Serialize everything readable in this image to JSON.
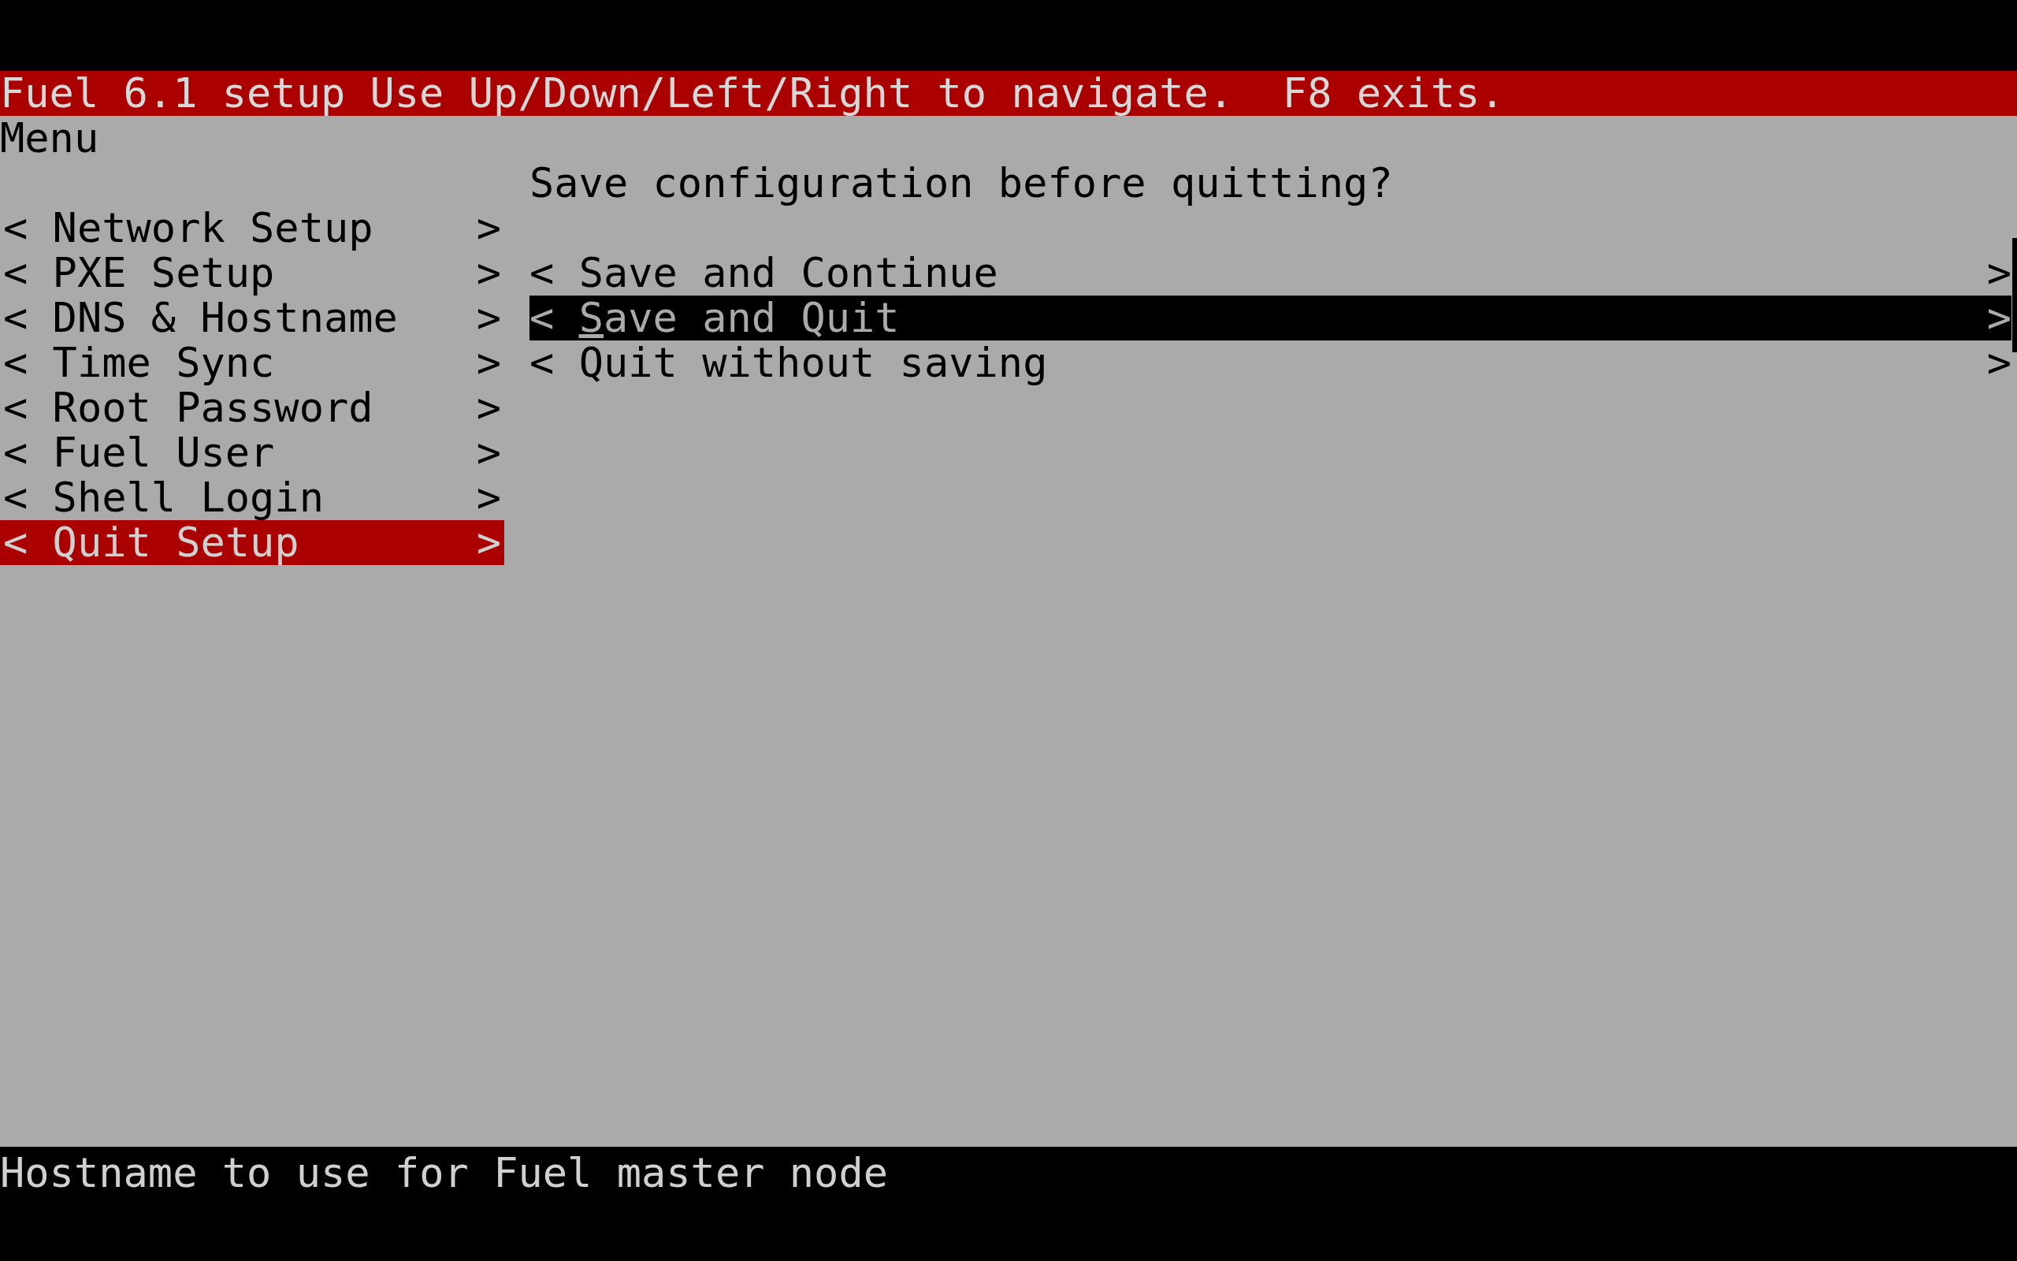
{
  "header": {
    "title": "Fuel 6.1 setup",
    "hint": "Use Up/Down/Left/Right to navigate.  F8 exits."
  },
  "menu": {
    "title": "Menu",
    "items": [
      {
        "left_mark": "<",
        "label": "Network Setup",
        "right_mark": ">",
        "selected": false
      },
      {
        "left_mark": "<",
        "label": "PXE Setup",
        "right_mark": ">",
        "selected": false
      },
      {
        "left_mark": "<",
        "label": "DNS & Hostname",
        "right_mark": ">",
        "selected": false
      },
      {
        "left_mark": "<",
        "label": "Time Sync",
        "right_mark": ">",
        "selected": false
      },
      {
        "left_mark": "<",
        "label": "Root Password",
        "right_mark": ">",
        "selected": false
      },
      {
        "left_mark": "<",
        "label": "Fuel User",
        "right_mark": ">",
        "selected": false
      },
      {
        "left_mark": "<",
        "label": "Shell Login",
        "right_mark": ">",
        "selected": false
      },
      {
        "left_mark": "<",
        "label": "Quit Setup",
        "right_mark": ">",
        "selected": true
      }
    ]
  },
  "dialog": {
    "question": "Save configuration before quitting?",
    "options": [
      {
        "left_mark": "<",
        "label": "Save and Continue",
        "right_mark": ">",
        "selected": false,
        "cursor": false
      },
      {
        "left_mark": "<",
        "label": "Save and Quit",
        "right_mark": ">",
        "selected": true,
        "cursor": true
      },
      {
        "left_mark": "<",
        "label": "Quit without saving",
        "right_mark": ">",
        "selected": false,
        "cursor": false
      }
    ]
  },
  "status_bar": "Hostname to use for Fuel master node"
}
